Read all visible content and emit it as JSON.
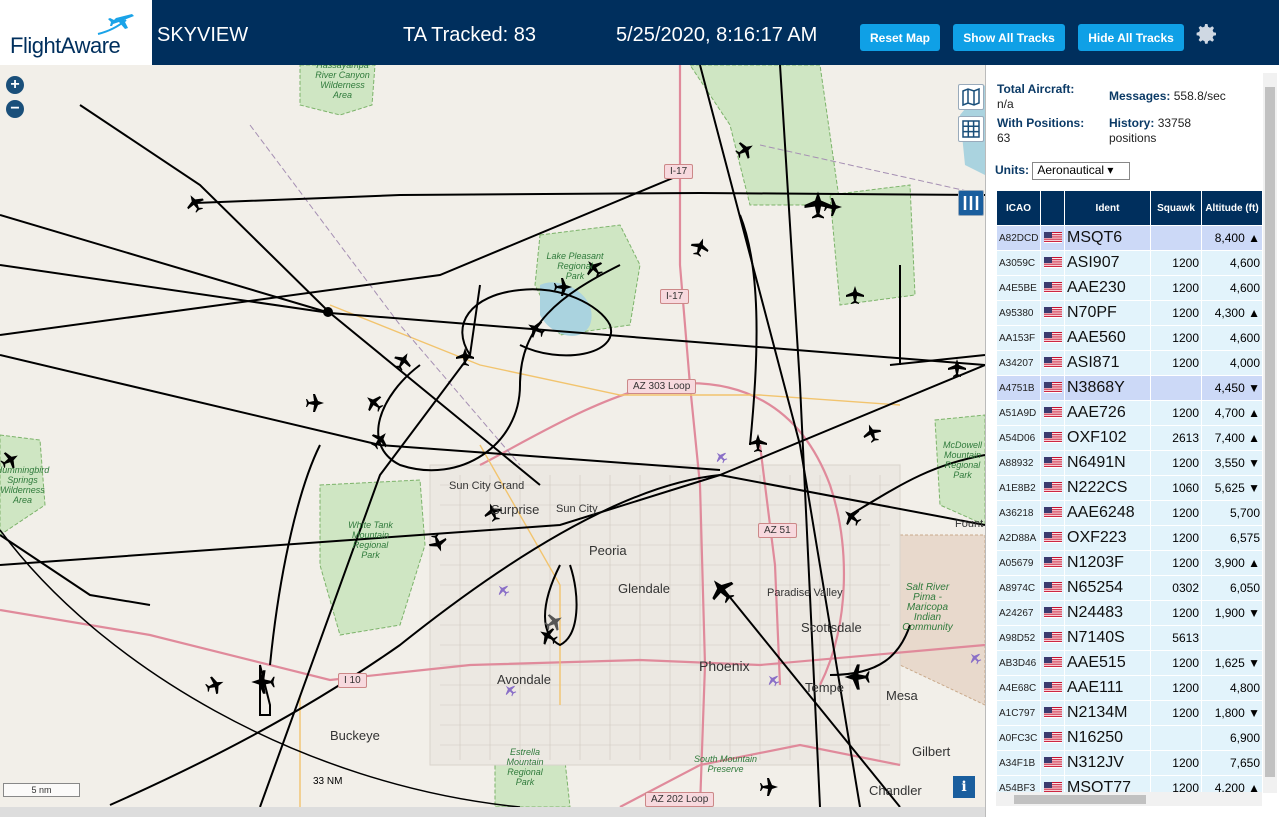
{
  "app": {
    "logo": "FlightAware",
    "title": "SKYVIEW",
    "tracked": "TA Tracked: 83",
    "datetime": "5/25/2020, 8:16:17 AM"
  },
  "toolbar": {
    "reset_label": "Reset Map",
    "show_label": "Show All Tracks",
    "hide_label": "Hide All Tracks"
  },
  "map": {
    "zoom_in": "+",
    "zoom_out": "−",
    "scale_label": "5 nm",
    "range_label": "33 NM",
    "info_label": "i",
    "labels": {
      "sun_city_grand": "Sun City Grand",
      "surprise": "Surprise",
      "sun_city": "Sun City",
      "peoria": "Peoria",
      "glendale": "Glendale",
      "paradise_valley": "Paradise Valley",
      "scottsdale": "Scottsdale",
      "phoenix": "Phoenix",
      "avondale": "Avondale",
      "tempe": "Tempe",
      "mesa": "Mesa",
      "buckeye": "Buckeye",
      "gilbert": "Gilbert",
      "chandler": "Chandler",
      "fountain": "Fount"
    },
    "parks": {
      "hassayampa": "Hassayampa\nRiver Canyon\nWilderness\nArea",
      "lake_pleasant": "Lake Pleasant\nRegional\nPark",
      "hummingbird": "Hummingbird\nSprings\nWilderness\nArea",
      "white_tank": "White Tank\nMountain\nRegional\nPark",
      "mcdowell": "McDowell\nMountain\nRegional\nPark",
      "salt_river": "Salt River\nPima -\nMaricopa\nIndian\nCommunity",
      "estrella": "Estrella\nMountain\nRegional\nPark",
      "south_mountain": "South Mountain\nPreserve"
    },
    "roads": {
      "i17_a": "I-17",
      "i17_b": "I-17",
      "az303": "AZ 303 Loop",
      "az51": "AZ 51",
      "i10": "I 10",
      "az202": "AZ 202 Loop"
    }
  },
  "stats": {
    "total_label": "Total Aircraft:",
    "total_value": "n/a",
    "positions_label": "With Positions:",
    "positions_value": "63",
    "messages_label": "Messages:",
    "messages_value": "558.8/sec",
    "history_label": "History:",
    "history_value": "33758",
    "history_unit": "positions"
  },
  "units": {
    "label": "Units:",
    "selected": "Aeronautical ▾"
  },
  "table": {
    "headers": {
      "icao": "ICAO",
      "ident": "Ident",
      "squawk": "Squawk",
      "altitude": "Altitude (ft)"
    },
    "rows": [
      {
        "icao": "A82DCD",
        "ident": "MSQT6",
        "squawk": "",
        "altitude": "8,400 ▲",
        "sel": true
      },
      {
        "icao": "A3059C",
        "ident": "ASI907",
        "squawk": "1200",
        "altitude": "4,600",
        "sel": false
      },
      {
        "icao": "A4E5BE",
        "ident": "AAE230",
        "squawk": "1200",
        "altitude": "4,600",
        "sel": false
      },
      {
        "icao": "A95380",
        "ident": "N70PF",
        "squawk": "1200",
        "altitude": "4,300 ▲",
        "sel": false
      },
      {
        "icao": "AA153F",
        "ident": "AAE560",
        "squawk": "1200",
        "altitude": "4,600",
        "sel": false
      },
      {
        "icao": "A34207",
        "ident": "ASI871",
        "squawk": "1200",
        "altitude": "4,000",
        "sel": false
      },
      {
        "icao": "A4751B",
        "ident": "N3868Y",
        "squawk": "",
        "altitude": "4,450 ▼",
        "sel": true
      },
      {
        "icao": "A51A9D",
        "ident": "AAE726",
        "squawk": "1200",
        "altitude": "4,700 ▲",
        "sel": false
      },
      {
        "icao": "A54D06",
        "ident": "OXF102",
        "squawk": "2613",
        "altitude": "7,400 ▲",
        "sel": false
      },
      {
        "icao": "A88932",
        "ident": "N6491N",
        "squawk": "1200",
        "altitude": "3,550 ▼",
        "sel": false
      },
      {
        "icao": "A1E8B2",
        "ident": "N222CS",
        "squawk": "1060",
        "altitude": "5,625 ▼",
        "sel": false
      },
      {
        "icao": "A36218",
        "ident": "AAE6248",
        "squawk": "1200",
        "altitude": "5,700",
        "sel": false
      },
      {
        "icao": "A2D88A",
        "ident": "OXF223",
        "squawk": "1200",
        "altitude": "6,575",
        "sel": false
      },
      {
        "icao": "A05679",
        "ident": "N1203F",
        "squawk": "1200",
        "altitude": "3,900 ▲",
        "sel": false
      },
      {
        "icao": "A8974C",
        "ident": "N65254",
        "squawk": "0302",
        "altitude": "6,050",
        "sel": false
      },
      {
        "icao": "A24267",
        "ident": "N24483",
        "squawk": "1200",
        "altitude": "1,900 ▼",
        "sel": false
      },
      {
        "icao": "A98D52",
        "ident": "N7140S",
        "squawk": "5613",
        "altitude": "",
        "sel": false
      },
      {
        "icao": "AB3D46",
        "ident": "AAE515",
        "squawk": "1200",
        "altitude": "1,625 ▼",
        "sel": false
      },
      {
        "icao": "A4E68C",
        "ident": "AAE111",
        "squawk": "1200",
        "altitude": "4,800",
        "sel": false
      },
      {
        "icao": "A1C797",
        "ident": "N2134M",
        "squawk": "1200",
        "altitude": "1,800 ▼",
        "sel": false
      },
      {
        "icao": "A0FC3C",
        "ident": "N16250",
        "squawk": "",
        "altitude": "6,900",
        "sel": false
      },
      {
        "icao": "A34F1B",
        "ident": "N312JV",
        "squawk": "1200",
        "altitude": "7,650",
        "sel": false
      },
      {
        "icao": "A54BF3",
        "ident": "MSQT77",
        "squawk": "1200",
        "altitude": "4,200 ▲",
        "sel": false
      }
    ]
  },
  "colors": {
    "header_bg": "#002f5d",
    "button_bg": "#0fa0e6",
    "row_bg": "#e2f3fb",
    "row_selected_bg": "#ccd9f7",
    "map_bg": "#f2efe9",
    "track": "#000000"
  },
  "icons": [
    "plane-logo-icon",
    "gear-icon",
    "zoom-in-icon",
    "zoom-out-icon",
    "map-layers-icon",
    "grid-icon",
    "columns-icon",
    "info-icon",
    "us-flag-icon",
    "aircraft-icon"
  ]
}
